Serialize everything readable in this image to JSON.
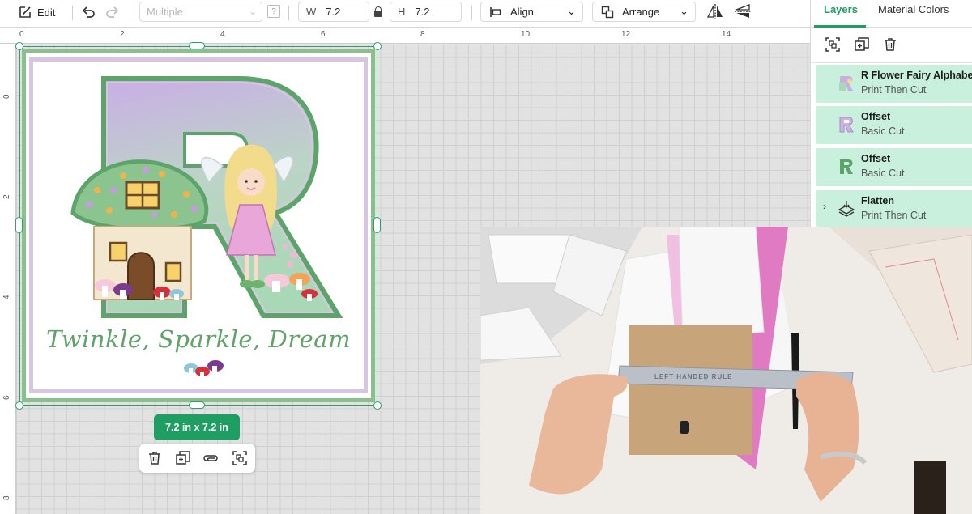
{
  "toolbar": {
    "edit_label": "Edit",
    "operation_placeholder": "Multiple",
    "help_label": "?",
    "width_label": "W",
    "width_value": "7.2",
    "height_label": "H",
    "height_value": "7.2",
    "align_label": "Align",
    "arrange_label": "Arrange"
  },
  "ruler": {
    "top_ticks": [
      "0",
      "2",
      "4",
      "6",
      "8",
      "10",
      "12",
      "14"
    ],
    "left_ticks": [
      "0",
      "2",
      "4",
      "6",
      "8"
    ]
  },
  "design": {
    "tagline": "Twinkle, Sparkle, Dream",
    "size_badge": "7.2  in x 7.2  in"
  },
  "panel": {
    "tabs": [
      "Layers",
      "Material Colors"
    ],
    "active_tab": "Layers",
    "layers": [
      {
        "name": "R Flower Fairy Alphabet",
        "type": "Print Then Cut",
        "thumb": "r-print-thumb"
      },
      {
        "name": "Offset",
        "type": "Basic Cut",
        "thumb": "r-lilac-thumb"
      },
      {
        "name": "Offset",
        "type": "Basic Cut",
        "thumb": "r-green-thumb"
      },
      {
        "name": "Flatten",
        "type": "Print Then Cut",
        "thumb": "flatten-icon"
      }
    ]
  },
  "video": {
    "ruler_text": "LEFT HANDED RULE"
  },
  "colors": {
    "accent": "#1e9e63",
    "layer_bg": "#c9efdd",
    "selection": "#27a26a",
    "letter_lilac": "#cdb2e6",
    "letter_green": "#5da46b"
  }
}
